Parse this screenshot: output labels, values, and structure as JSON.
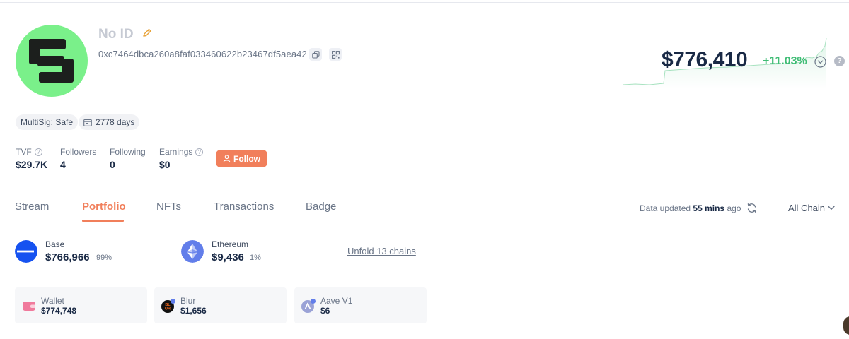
{
  "profile": {
    "name": "No ID",
    "address": "0xc7464dbca260a8faf033460622b23467df5aea42",
    "tags": [
      "MultiSig: Safe",
      "2778 days"
    ],
    "stats": [
      {
        "label": "TVF",
        "value": "$29.7K"
      },
      {
        "label": "Followers",
        "value": "4"
      },
      {
        "label": "Following",
        "value": "0"
      },
      {
        "label": "Earnings",
        "value": "$0"
      }
    ],
    "follow_label": "Follow"
  },
  "net_worth": {
    "value": "$776,410",
    "change": "+11.03%",
    "change_color": "#3ebc74"
  },
  "tabs": [
    "Stream",
    "Portfolio",
    "NFTs",
    "Transactions",
    "Badge"
  ],
  "active_tab": "Portfolio",
  "status": {
    "prefix": "Data updated ",
    "time": "55 mins",
    "suffix": " ago",
    "chain_filter": "All Chain"
  },
  "chains": [
    {
      "name": "Base",
      "value": "$766,966",
      "pct": "99%"
    },
    {
      "name": "Ethereum",
      "value": "$9,436",
      "pct": "1%"
    }
  ],
  "unfold_label": "Unfold 13 chains",
  "protocols": [
    {
      "name": "Wallet",
      "value": "$774,748"
    },
    {
      "name": "Blur",
      "value": "$1,656"
    },
    {
      "name": "Aave V1",
      "value": "$6"
    }
  ],
  "colors": {
    "accent": "#f17f5b",
    "avatar": "#7af08a",
    "base": "#1652f0",
    "ethereum": "#627eea"
  },
  "icons": [
    "pencil-icon",
    "copy-icon",
    "qr-code-icon",
    "calendar-icon",
    "help-icon",
    "user-icon",
    "refresh-icon",
    "chevron-down-icon",
    "chevron-down-circle-icon"
  ]
}
